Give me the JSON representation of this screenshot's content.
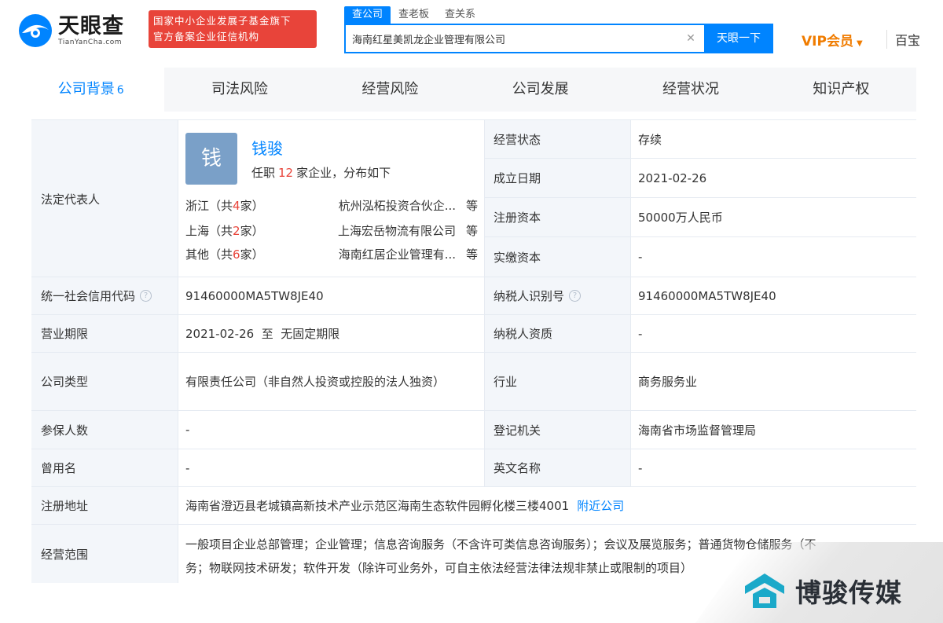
{
  "header": {
    "logo_cn": "天眼查",
    "logo_en": "TianYanCha.com",
    "badge_line1": "国家中小企业发展子基金旗下",
    "badge_line2": "官方备案企业征信机构",
    "search_tabs": [
      "查公司",
      "查老板",
      "查关系"
    ],
    "search_value": "海南红星美凯龙企业管理有限公司",
    "search_button": "天眼一下",
    "vip_label": "VIP会员",
    "cut_text": "百宝"
  },
  "nav": {
    "tabs": [
      {
        "label": "公司背景",
        "count": "6"
      },
      {
        "label": "司法风险"
      },
      {
        "label": "经营风险"
      },
      {
        "label": "公司发展"
      },
      {
        "label": "经营状况"
      },
      {
        "label": "知识产权"
      }
    ]
  },
  "info": {
    "legal_rep": {
      "label": "法定代表人",
      "avatar_char": "钱",
      "name": "钱骏",
      "sub_prefix": "任职",
      "sub_count": "12",
      "sub_suffix": "家企业，分布如下",
      "distribution": [
        {
          "region_pre": "浙江（共",
          "count": "4",
          "region_post": "家）",
          "company": "杭州泓柘投资合伙企...",
          "etc": "等"
        },
        {
          "region_pre": "上海（共",
          "count": "2",
          "region_post": "家）",
          "company": "上海宏岳物流有限公司",
          "etc": "等"
        },
        {
          "region_pre": "其他（共",
          "count": "6",
          "region_post": "家）",
          "company": "海南红居企业管理有...",
          "etc": "等"
        }
      ]
    },
    "status": {
      "label": "经营状态",
      "value": "存续"
    },
    "founded": {
      "label": "成立日期",
      "value": "2021-02-26"
    },
    "reg_capital": {
      "label": "注册资本",
      "value": "50000万人民币"
    },
    "paid_capital": {
      "label": "实缴资本",
      "value": "-"
    },
    "credit_code": {
      "label": "统一社会信用代码",
      "value": "91460000MA5TW8JE40"
    },
    "taxpayer_id": {
      "label": "纳税人识别号",
      "value": "91460000MA5TW8JE40"
    },
    "term": {
      "label": "营业期限",
      "value": "2021-02-26  至  无固定期限"
    },
    "taxpayer_qual": {
      "label": "纳税人资质",
      "value": "-"
    },
    "company_type": {
      "label": "公司类型",
      "value": "有限责任公司（非自然人投资或控股的法人独资）"
    },
    "industry": {
      "label": "行业",
      "value": "商务服务业"
    },
    "insured": {
      "label": "参保人数",
      "value": "-"
    },
    "registrar": {
      "label": "登记机关",
      "value": "海南省市场监督管理局"
    },
    "former_name": {
      "label": "曾用名",
      "value": "-"
    },
    "english_name": {
      "label": "英文名称",
      "value": "-"
    },
    "address": {
      "label": "注册地址",
      "value": "海南省澄迈县老城镇高新技术产业示范区海南生态软件园孵化楼三楼4001",
      "link": "附近公司"
    },
    "scope": {
      "label": "经营范围",
      "line1": "一般项目企业总部管理；企业管理；信息咨询服务（不含许可类信息咨询服务）；会议及展览服务；普通货物仓储服务（不",
      "line2": "务；物联网技术研发；软件开发（除许可业务外，可自主依法经营法律法规非禁止或限制的项目）"
    }
  },
  "watermark": {
    "text": "博骏传媒"
  },
  "colors": {
    "accent": "#0084ff",
    "badge": "#e8443a",
    "vip": "#f07c00",
    "label_bg": "#f3f6fa"
  }
}
